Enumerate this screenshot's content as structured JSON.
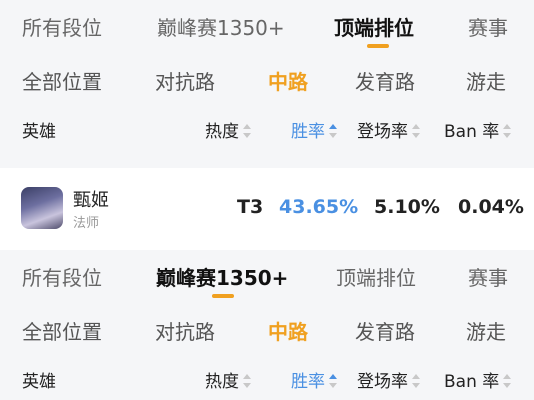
{
  "rank_tabs": [
    "所有段位",
    "巅峰赛1350+",
    "顶端排位",
    "赛事"
  ],
  "lane_tabs": [
    "全部位置",
    "对抗路",
    "中路",
    "发育路",
    "游走"
  ],
  "headers": {
    "hero": "英雄",
    "heat": "热度",
    "winrate": "胜率",
    "pickrate": "登场率",
    "banrate": "Ban 率"
  },
  "hero": {
    "name": "甄姬",
    "role": "法师",
    "tier": "T3",
    "winrate": "43.65%",
    "pickrate": "5.10%",
    "banrate": "0.04%"
  },
  "colors": {
    "accent": "#f0a020",
    "sort_active": "#4a90e2",
    "background": "#f5f6f8"
  }
}
